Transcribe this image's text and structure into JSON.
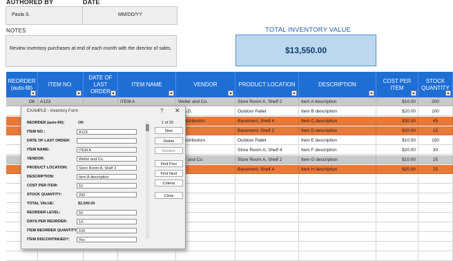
{
  "header": {
    "authored_by_label": "AUTHORED BY",
    "date_label": "DATE",
    "author": "Paula S.",
    "date": "MM/DD/YY",
    "notes_label": "NOTES",
    "notes_text": "Review inventory purchases at end of each month with the director of sales.",
    "total_label": "TOTAL INVENTORY VALUE",
    "total_value": "$13,550.00"
  },
  "colors": {
    "header_blue": "#1f6ed4",
    "total_box": "#bcd8ef",
    "orange": "#e7793a",
    "gray": "#c9c9c9"
  },
  "columns": [
    {
      "label": "REORDER\n(auto-fill)"
    },
    {
      "label": "ITEM NO."
    },
    {
      "label": "DATE OF\nLAST ORDER"
    },
    {
      "label": "ITEM NAME"
    },
    {
      "label": "VENDOR"
    },
    {
      "label": "PRODUCT LOCATION"
    },
    {
      "label": "DESCRIPTION"
    },
    {
      "label": "COST PER\nITEM"
    },
    {
      "label": "STOCK\nQUANTITY"
    }
  ],
  "rows": [
    {
      "style": "gray",
      "reorder": "OK",
      "item_no": "A123",
      "date": "",
      "name": "ITEM A",
      "vendor": "Weller and Co.",
      "location": "Store Room A, Shelf 2",
      "description": "Item A description",
      "cost": "$10.00",
      "qty": "200"
    },
    {
      "style": "white",
      "reorder": "OK",
      "item_no": "",
      "date": "",
      "name": "",
      "vendor": "own D.",
      "location": "Outdoor Pallet",
      "description": "Item B description",
      "cost": "$20.00",
      "qty": "100"
    },
    {
      "style": "orange",
      "reorder": "REOR",
      "item_no": "",
      "date": "",
      "name": "",
      "vendor": "'s Distributors",
      "location": "Basement, Shelf 4",
      "description": "Item C description",
      "cost": "$30.00",
      "qty": "45"
    },
    {
      "style": "orange",
      "reorder": "REOR",
      "item_no": "",
      "date": "",
      "name": "",
      "vendor": "ole",
      "location": "Basement, Shelf 2",
      "description": "Item D description",
      "cost": "$20.00",
      "qty": "15"
    },
    {
      "style": "white",
      "reorder": "OK",
      "item_no": "",
      "date": "",
      "name": "",
      "vendor": "'s Distributors",
      "location": "Outdoor Pallet",
      "description": "Item E description",
      "cost": "$10.00",
      "qty": "150"
    },
    {
      "style": "white",
      "reorder": "OK",
      "item_no": "",
      "date": "",
      "name": "",
      "vendor": "ole",
      "location": "Store Room A, Shelf 4",
      "description": "Item F description",
      "cost": "$20.00",
      "qty": "30"
    },
    {
      "style": "gray",
      "reorder": "REOR",
      "item_no": "",
      "date": "",
      "name": "",
      "vendor": "eller and Co.",
      "location": "Store Room A, Shelf 2",
      "description": "Item G description",
      "cost": "$10.00",
      "qty": "25"
    },
    {
      "style": "orange",
      "reorder": "REOR",
      "item_no": "",
      "date": "",
      "name": "",
      "vendor": "ole",
      "location": "Basement, Shelf 4",
      "description": "Item H description",
      "cost": "$20.00",
      "qty": "25"
    }
  ],
  "dialog": {
    "title": "EXAMPLE - Inventory Form",
    "help": "?",
    "close": "✕",
    "record_counter": "1 of 20",
    "fields": [
      {
        "label": "REORDER (auto-fill):",
        "value": "OK",
        "type": "static"
      },
      {
        "label": "ITEM NO.:",
        "value": "A123",
        "type": "input"
      },
      {
        "label": "DATE OF LAST ORDER:",
        "value": "",
        "type": "input"
      },
      {
        "label": "ITEM NAME:",
        "value": "ITEM A",
        "type": "input"
      },
      {
        "label": "VENDOR:",
        "value": "Weller and Co.",
        "type": "input"
      },
      {
        "label": "PRODUCT LOCATION:",
        "value": "Store Room A, Shelf 2",
        "type": "input"
      },
      {
        "label": "DESCRIPTION:",
        "value": "Item A description",
        "type": "input"
      },
      {
        "label": "COST PER ITEM:",
        "value": "10",
        "type": "input"
      },
      {
        "label": "STOCK QUANTITY:",
        "value": "200",
        "type": "input"
      },
      {
        "label": "TOTAL VALUE:",
        "value": "$2,000.00",
        "type": "static"
      },
      {
        "label": "REORDER LEVEL:",
        "value": "50",
        "type": "input"
      },
      {
        "label": "DAYS PER REORDER:",
        "value": "14",
        "type": "input"
      },
      {
        "label": "ITEM REORDER QUANTITY:",
        "value": "100",
        "type": "input"
      },
      {
        "label": "ITEM DISCONTINUED?:",
        "value": "Yes",
        "type": "input"
      }
    ],
    "buttons": {
      "new": "New",
      "delete": "Delete",
      "restore": "Restore",
      "find_prev": "Find Prev",
      "find_next": "Find Next",
      "criteria": "Criteria",
      "close": "Close"
    }
  }
}
